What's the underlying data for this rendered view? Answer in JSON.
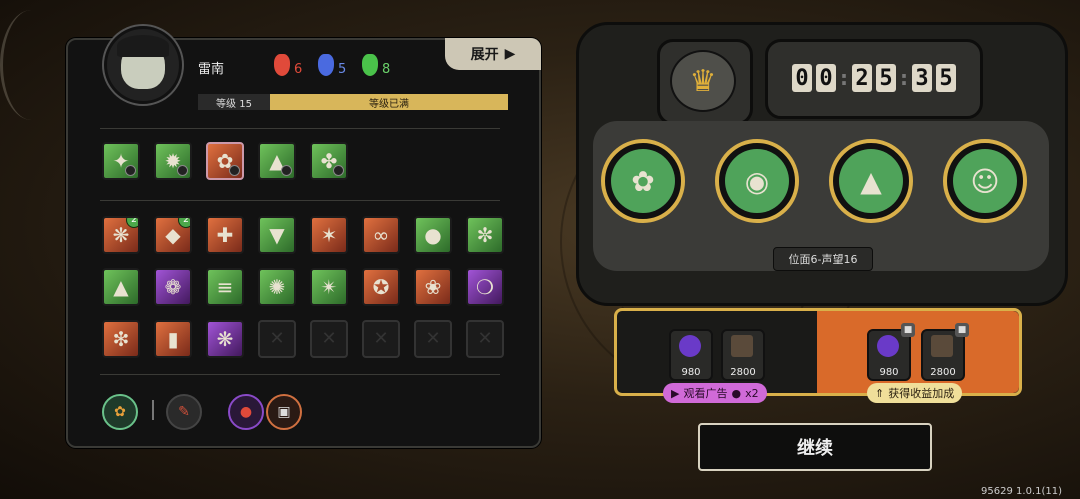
{
  "player": {
    "name": "雷南",
    "masks": [
      {
        "icon": "red-mask-icon",
        "count": "6",
        "color": "#e04a3a"
      },
      {
        "icon": "blue-mask-icon",
        "count": "5",
        "color": "#4a6ae0"
      },
      {
        "icon": "green-mask-icon",
        "count": "8",
        "color": "#4ac24a"
      }
    ],
    "level_label": "等级 15",
    "level_status": "等级已满",
    "expand_label": "展开"
  },
  "skills": {
    "row1": [
      "g",
      "g",
      "r",
      "g",
      "g"
    ],
    "grid": [
      [
        "r",
        "r",
        "r",
        "g",
        "r",
        "r",
        "g",
        "g"
      ],
      [
        "g",
        "p",
        "g",
        "g",
        "g",
        "r",
        "r",
        "p"
      ],
      [
        "r",
        "r",
        "p",
        "x",
        "x",
        "x",
        "x",
        "x"
      ]
    ]
  },
  "machine": {
    "timer": "00:25:35",
    "plane_label": "位面6-声望16"
  },
  "rewards": {
    "left": [
      {
        "icon": "purple-orb-icon",
        "value": "980"
      },
      {
        "icon": "card-icon",
        "value": "2800"
      }
    ],
    "right": [
      {
        "icon": "purple-orb-icon",
        "value": "980"
      },
      {
        "icon": "card-icon",
        "value": "2800"
      }
    ],
    "watch_ad_label": "观看广告",
    "watch_ad_mult": "x2",
    "boost_label": "获得收益加成"
  },
  "continue_label": "继续",
  "version": "95629 1.0.1(11)"
}
